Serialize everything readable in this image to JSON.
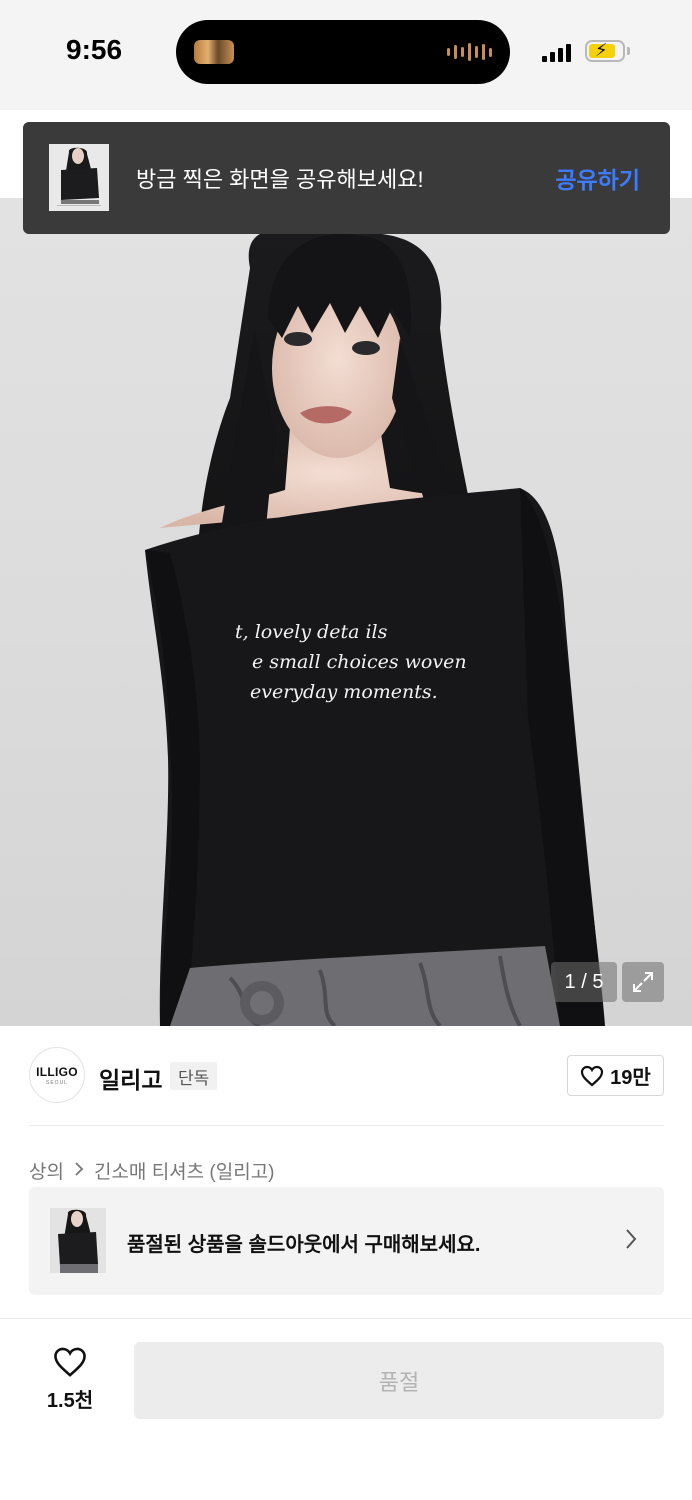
{
  "status_bar": {
    "time": "9:56"
  },
  "share_toast": {
    "message": "방금 찍은 화면을 공유해보세요!",
    "action_label": "공유하기"
  },
  "hero": {
    "shirt_text": [
      "t, lovely deta ils",
      "e small choices woven",
      "everyday moments."
    ],
    "image_counter": "1 / 5"
  },
  "brand": {
    "logo_text": "ILLIGO",
    "logo_sub": "SEOUL",
    "name": "일리고",
    "badge": "단독",
    "like_count": "19만"
  },
  "breadcrumb": {
    "category": "상의",
    "subcategory": "긴소매 티셔츠 (일리고)"
  },
  "soldout_banner": {
    "text": "품절된 상품을 솔드아웃에서 구매해보세요."
  },
  "bottom_bar": {
    "wish_count": "1.5천",
    "buy_button_label": "품절"
  },
  "colors": {
    "accent_blue": "#3d7bff",
    "toast_bg": "#3a3a3a",
    "disabled_button_bg": "#ececec",
    "battery_yellow": "#f5d10a"
  }
}
